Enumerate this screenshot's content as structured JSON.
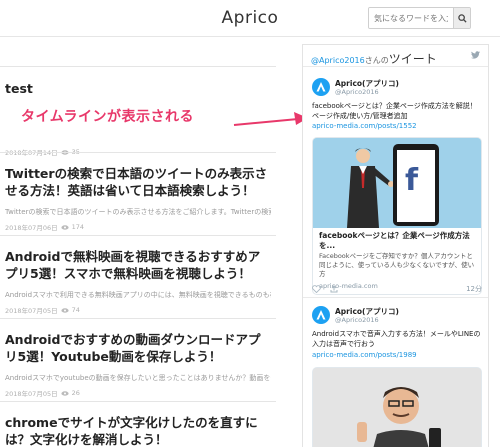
{
  "header": {
    "logo": "Aprico",
    "search_placeholder": "気になるワードを入力"
  },
  "posts": [
    {
      "title": "test",
      "excerpt": "",
      "date": "2018年07月14日",
      "views": "35"
    },
    {
      "title": "Twitterの検索で日本語のツイートのみ表示させる方法！英語は省いて日本語検索しよう！",
      "excerpt": "Twitterの検索で日本語のツイートのみ表示させる方法をご紹介します。Twitterの検索結...",
      "date": "2018年07月06日",
      "views": "174"
    },
    {
      "title": "Androidで無料映画を視聴できるおすすめアプリ5選！スマホで無料映画を視聴しよう！",
      "excerpt": "Androidスマホで利用できる無料映画アプリの中には、無料映画を視聴できるものも存在して...",
      "date": "2018年07月05日",
      "views": "74"
    },
    {
      "title": "Androidでおすすめの動画ダウンロードアプリ5選！Youtube動画を保存しよう！",
      "excerpt": "Androidスマホでyoutubeの動画を保存したいと思ったことはありませんか？動画をダウ...",
      "date": "2018年07月05日",
      "views": "26"
    },
    {
      "title": "chromeでサイトが文字化けしたのを直すには？文字化けを解消しよう！",
      "excerpt": "",
      "date": "",
      "views": ""
    }
  ],
  "annotation": "タイムラインが表示される",
  "sidebar": {
    "handle_prefix": "@Aprico2016",
    "handle_suffix": "さんの",
    "title": "ツイート",
    "tweets": [
      {
        "name": "Aprico(アプリコ)",
        "handle": "@Aprico2016",
        "text": "facebookページとは？企業ページ作成方法を解説！ページ作成/使い方/管理者追加",
        "link": "aprico-media.com/posts/1552",
        "card_title": "facebookページとは？企業ページ作成方法を...",
        "card_desc": "Facebookページをご存知ですか？個人アカウントと同じように、使っている人も少なくないですが、使い方",
        "card_domain": "aprico-media.com",
        "time": "12分"
      },
      {
        "name": "Aprico(アプリコ)",
        "handle": "@Aprico2016",
        "text": "Androidスマホで音声入力する方法！メールやLINEの入力は音声で行おう",
        "link": "aprico-media.com/posts/1989"
      }
    ]
  },
  "colors": {
    "accent_pink": "#e8386a",
    "twitter_blue": "#1da1f2",
    "link_blue": "#1b95e0"
  }
}
